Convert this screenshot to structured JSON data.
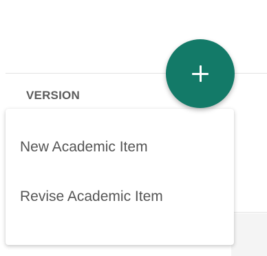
{
  "table": {
    "column_header": "VERSION"
  },
  "fab": {
    "icon": "plus-icon",
    "color": "#137a68"
  },
  "menu": {
    "items": [
      {
        "label": "New Academic Item"
      },
      {
        "label": "Revise Academic Item"
      }
    ]
  }
}
